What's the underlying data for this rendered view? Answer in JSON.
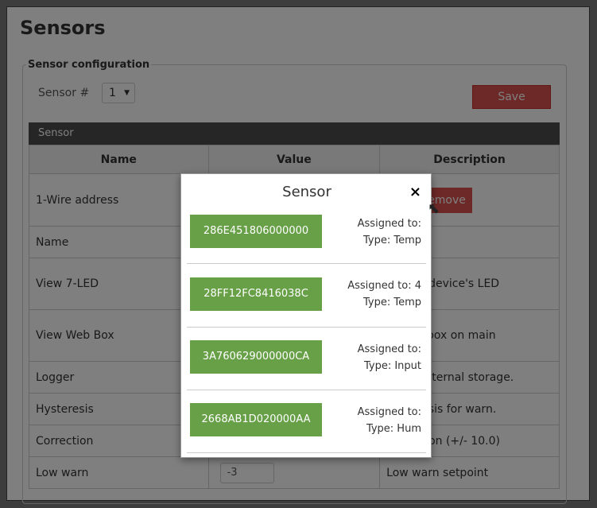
{
  "page_title": "Sensors",
  "config": {
    "legend": "Sensor configuration",
    "sensor_label": "Sensor #",
    "sensor_value": "1",
    "save_label": "Save"
  },
  "panel": {
    "header": "Sensor"
  },
  "table": {
    "headers": [
      "Name",
      "Value",
      "Description"
    ],
    "rows": [
      {
        "name": "1-Wire address",
        "value": "",
        "description": ""
      },
      {
        "name": "Name",
        "value": "",
        "description": ""
      },
      {
        "name": "View 7-LED",
        "value": "",
        "description": "alue at device's LED"
      },
      {
        "name": "View Web Box",
        "value": "",
        "description": "sensor box on main"
      },
      {
        "name": "Logger",
        "value": "",
        "description": "log to internal storage."
      },
      {
        "name": "Hysteresis",
        "value": "",
        "description": "hysteresis for warn."
      },
      {
        "name": "Correction",
        "value": "",
        "description": "correction (+/- 10.0)"
      },
      {
        "name": "Low warn",
        "value": "-3",
        "description": "Low warn setpoint"
      }
    ],
    "remove_label": "Remove",
    "blue_btn_label": "n"
  },
  "modal": {
    "title": "Sensor",
    "close_symbol": "×",
    "items": [
      {
        "address": "286E451806000000",
        "assigned": "Assigned to:",
        "type": "Type: Temp"
      },
      {
        "address": "28FF12FC8416038C",
        "assigned": "Assigned to: 4",
        "type": "Type: Temp"
      },
      {
        "address": "3A760629000000CA",
        "assigned": "Assigned to:",
        "type": "Type: Input"
      },
      {
        "address": "2668AB1D020000AA",
        "assigned": "Assigned to:",
        "type": "Type: Hum"
      }
    ]
  }
}
